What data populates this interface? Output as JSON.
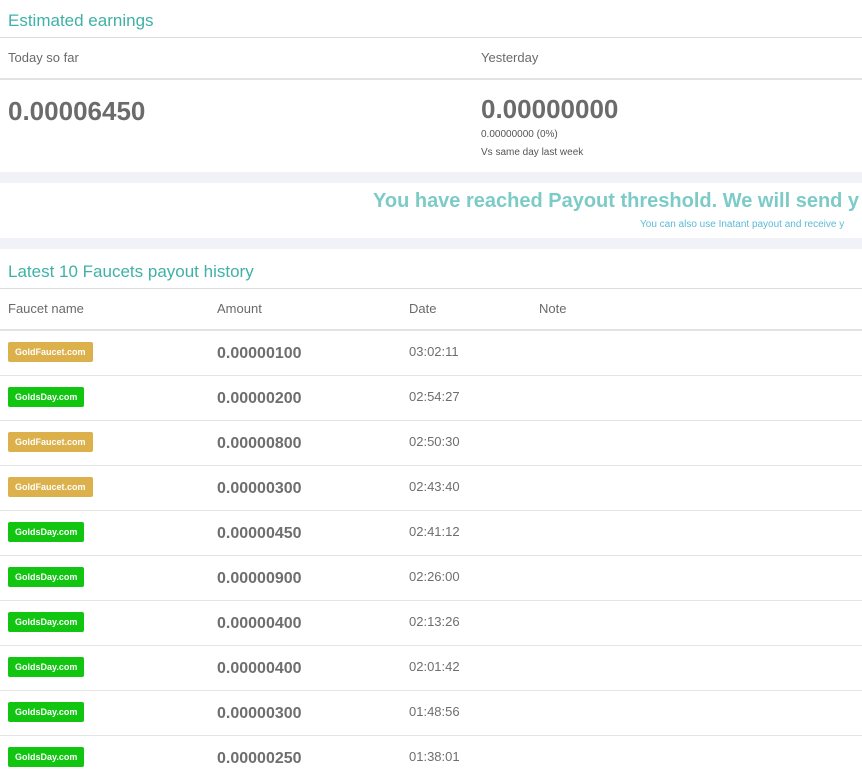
{
  "earnings": {
    "title": "Estimated earnings",
    "today": {
      "label": "Today so far",
      "value": "0.00006450"
    },
    "yesterday": {
      "label": "Yesterday",
      "value": "0.00000000",
      "change": "0.00000000 (0%)",
      "compare_label": "Vs same day last week"
    }
  },
  "threshold": {
    "message": "You have reached Payout threshold. We will send y",
    "sub_message": "You can also use Inatant payout and receive y"
  },
  "history": {
    "title": "Latest 10 Faucets payout history",
    "columns": {
      "faucet": "Faucet name",
      "amount": "Amount",
      "date": "Date",
      "note": "Note"
    },
    "rows": [
      {
        "faucet": "GoldFaucet.com",
        "amount": "0.00000100",
        "date": "03:02:11",
        "note": ""
      },
      {
        "faucet": "GoldsDay.com",
        "amount": "0.00000200",
        "date": "02:54:27",
        "note": ""
      },
      {
        "faucet": "GoldFaucet.com",
        "amount": "0.00000800",
        "date": "02:50:30",
        "note": ""
      },
      {
        "faucet": "GoldFaucet.com",
        "amount": "0.00000300",
        "date": "02:43:40",
        "note": ""
      },
      {
        "faucet": "GoldsDay.com",
        "amount": "0.00000450",
        "date": "02:41:12",
        "note": ""
      },
      {
        "faucet": "GoldsDay.com",
        "amount": "0.00000900",
        "date": "02:26:00",
        "note": ""
      },
      {
        "faucet": "GoldsDay.com",
        "amount": "0.00000400",
        "date": "02:13:26",
        "note": ""
      },
      {
        "faucet": "GoldsDay.com",
        "amount": "0.00000400",
        "date": "02:01:42",
        "note": ""
      },
      {
        "faucet": "GoldsDay.com",
        "amount": "0.00000300",
        "date": "01:48:56",
        "note": ""
      },
      {
        "faucet": "GoldsDay.com",
        "amount": "0.00000250",
        "date": "01:38:01",
        "note": ""
      }
    ]
  },
  "colors": {
    "accent": "#3fb1a7",
    "goldfaucet_badge": "#dcb04b",
    "goldsday_badge": "#11c511"
  }
}
